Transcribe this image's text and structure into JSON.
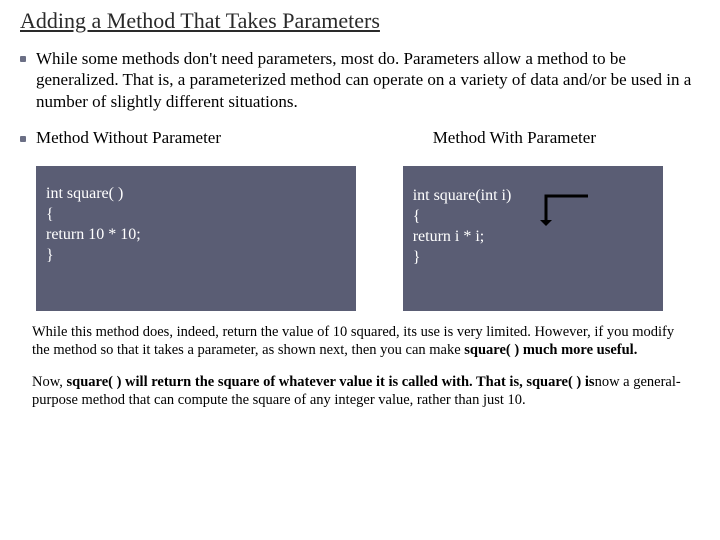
{
  "title": "Adding a Method That Takes Parameters",
  "intro": "While some methods don't need parameters, most do. Parameters allow a method to be generalized. That is, a parameterized method can operate on a variety of data and/or be used in a number of slightly different situations.",
  "left": {
    "heading": "Method Without  Parameter",
    "code": "int square( )\n{\nreturn 10 * 10;\n}"
  },
  "right": {
    "heading": "Method With Parameter",
    "code": "int square(int i)\n{\nreturn i * i;\n}"
  },
  "para1_before": "While this method does, indeed, return the value of 10 squared, its use is very limited. However, if you modify the method so that it takes a parameter, as shown next, then you can make ",
  "para1_bold": "square( ) much more useful.",
  "para2_before": "Now, ",
  "para2_bold": "square( ) will return the square of whatever value it is called with. That is, square( ) is",
  "para2_after": "now a general-purpose method that can compute the square of any integer value, rather than just 10.",
  "colors": {
    "box_bg": "#5a5d74",
    "bullet": "#6b6f85"
  }
}
